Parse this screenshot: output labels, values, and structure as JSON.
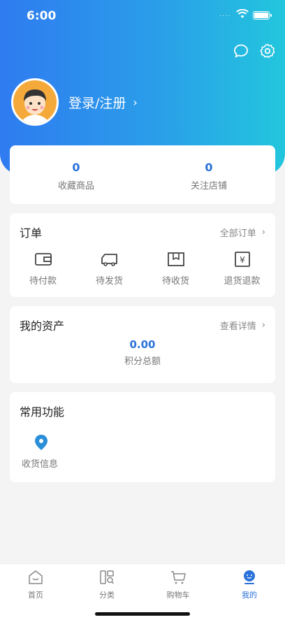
{
  "status_bar": {
    "time": "6:00"
  },
  "profile": {
    "login_label": "登录/注册"
  },
  "stats": [
    {
      "value": "0",
      "label": "收藏商品"
    },
    {
      "value": "0",
      "label": "关注店铺"
    }
  ],
  "orders": {
    "title": "订单",
    "link": "全部订单",
    "items": [
      {
        "label": "待付款",
        "icon": "wallet-icon"
      },
      {
        "label": "待发货",
        "icon": "truck-icon"
      },
      {
        "label": "待收货",
        "icon": "package-icon"
      },
      {
        "label": "退货退款",
        "icon": "refund-icon"
      }
    ]
  },
  "assets": {
    "title": "我的资产",
    "link": "查看详情",
    "value": "0.00",
    "label": "积分总额"
  },
  "functions": {
    "title": "常用功能",
    "items": [
      {
        "label": "收货信息",
        "icon": "location-pin-icon"
      }
    ]
  },
  "tabbar": {
    "items": [
      {
        "label": "首页",
        "icon": "home-icon",
        "active": false
      },
      {
        "label": "分类",
        "icon": "category-icon",
        "active": false
      },
      {
        "label": "购物车",
        "icon": "cart-icon",
        "active": false
      },
      {
        "label": "我的",
        "icon": "user-icon",
        "active": true
      }
    ]
  },
  "colors": {
    "accent": "#2a72d9",
    "gradient_start": "#2f7bf0",
    "gradient_end": "#22c6dd"
  }
}
